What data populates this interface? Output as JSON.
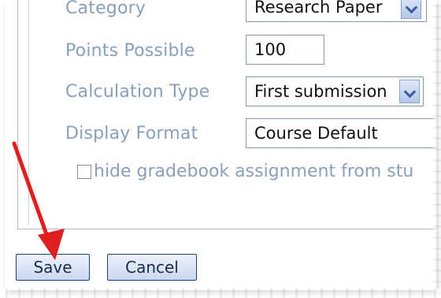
{
  "form": {
    "category": {
      "label": "Category",
      "value": "Research Paper"
    },
    "points": {
      "label": "Points Possible",
      "value": "100"
    },
    "calculation": {
      "label": "Calculation Type",
      "value": "First submission"
    },
    "display": {
      "label": "Display Format",
      "value": "Course Default"
    },
    "hide_checkbox_label": "hide gradebook assignment from stu"
  },
  "buttons": {
    "save": "Save",
    "cancel": "Cancel"
  },
  "colors": {
    "annotation_arrow": "#e02020",
    "label_text": "#8aa0ba",
    "button_border": "#1f3f7a"
  }
}
